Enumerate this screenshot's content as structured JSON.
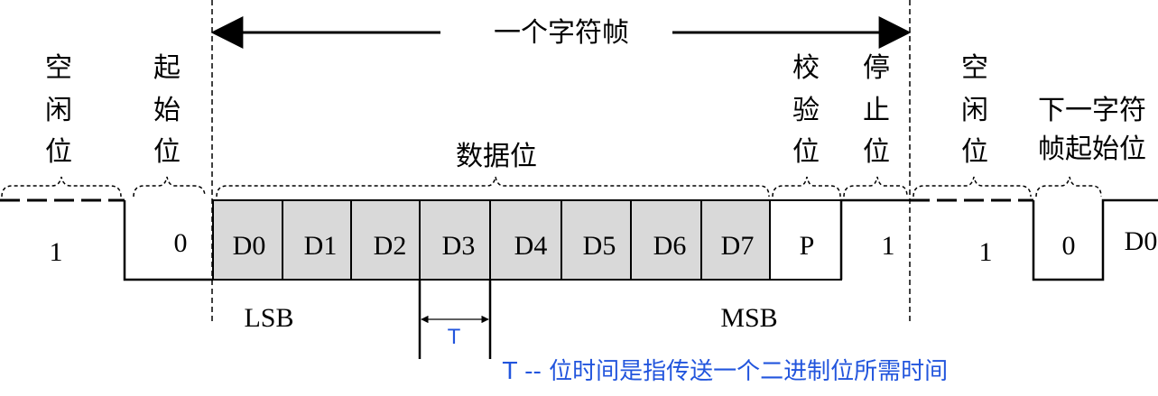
{
  "frame_title": "一个字符帧",
  "labels": {
    "idle_left": [
      "空",
      "闲",
      "位"
    ],
    "start_bit": [
      "起",
      "始",
      "位"
    ],
    "data_bits": "数据位",
    "parity_bit": [
      "校",
      "验",
      "位"
    ],
    "stop_bit": [
      "停",
      "止",
      "位"
    ],
    "idle_right": [
      "空",
      "闲",
      "位"
    ],
    "next_start_line1": "下一字符",
    "next_start_line2": "帧起始位"
  },
  "values": {
    "idle_left": "1",
    "start": "0",
    "parity": "P",
    "stop": "1",
    "idle_right": "1",
    "next_start": "0",
    "next_data": "D0"
  },
  "data_bit_names": [
    "D0",
    "D1",
    "D2",
    "D3",
    "D4",
    "D5",
    "D6",
    "D7"
  ],
  "lsb_label": "LSB",
  "msb_label": "MSB",
  "t_label": "T",
  "t_note": "T -- 位时间是指传送一个二进制位所需时间",
  "colors": {
    "line": "#000000",
    "data_fill": "#d9d9d9",
    "note": "#2255dd"
  }
}
